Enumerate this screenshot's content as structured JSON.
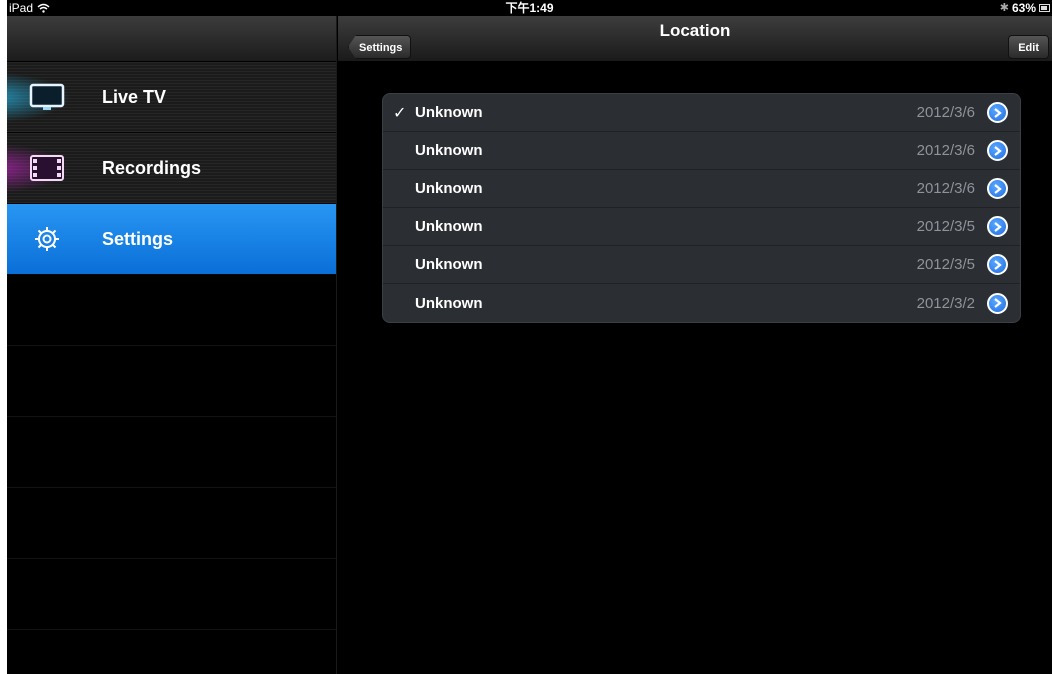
{
  "status_bar": {
    "device": "iPad",
    "time": "下午1:49",
    "battery": "63%",
    "battery_level": 0.63
  },
  "sidebar": {
    "items": [
      {
        "label": "Live TV",
        "icon": "tv-icon",
        "active": false
      },
      {
        "label": "Recordings",
        "icon": "film-icon",
        "active": false
      },
      {
        "label": "Settings",
        "icon": "gear-icon",
        "active": true
      }
    ]
  },
  "navbar": {
    "title": "Location",
    "back_label": "Settings",
    "edit_label": "Edit"
  },
  "locations": [
    {
      "name": "Unknown",
      "date": "2012/3/6",
      "checked": true
    },
    {
      "name": "Unknown",
      "date": "2012/3/6",
      "checked": false
    },
    {
      "name": "Unknown",
      "date": "2012/3/6",
      "checked": false
    },
    {
      "name": "Unknown",
      "date": "2012/3/5",
      "checked": false
    },
    {
      "name": "Unknown",
      "date": "2012/3/5",
      "checked": false
    },
    {
      "name": "Unknown",
      "date": "2012/3/2",
      "checked": false
    }
  ],
  "colors": {
    "active_blue": "#1a82e8",
    "disclosure_blue": "#2a7cf0"
  }
}
